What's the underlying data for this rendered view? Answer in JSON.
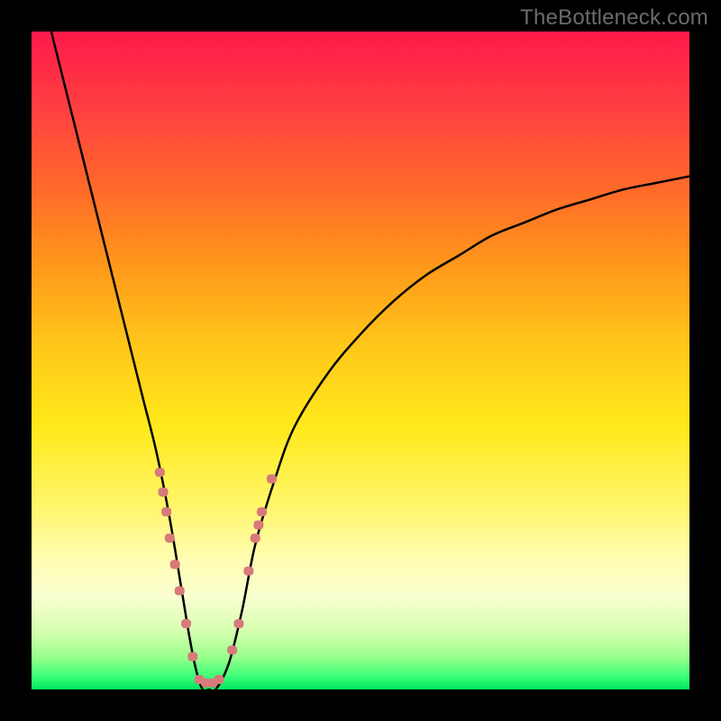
{
  "watermark": "TheBottleneck.com",
  "chart_data": {
    "type": "line",
    "title": "",
    "xlabel": "",
    "ylabel": "",
    "xlim": [
      0,
      100
    ],
    "ylim": [
      0,
      100
    ],
    "background_gradient": {
      "top": "#ff1a4b",
      "middle": "#ffe91a",
      "bottom": "#00e760"
    },
    "series": [
      {
        "name": "bottleneck-curve",
        "x": [
          3,
          5,
          7,
          9,
          11,
          13,
          15,
          17,
          19,
          21,
          23,
          24,
          25,
          26,
          27,
          28,
          30,
          32,
          34,
          37,
          40,
          45,
          50,
          55,
          60,
          65,
          70,
          75,
          80,
          85,
          90,
          95,
          100
        ],
        "y": [
          100,
          92,
          84,
          76,
          68,
          60,
          52,
          44,
          36,
          26,
          14,
          8,
          3,
          0,
          0,
          0,
          4,
          12,
          22,
          32,
          40,
          48,
          54,
          59,
          63,
          66,
          69,
          71,
          73,
          74.5,
          76,
          77,
          78
        ],
        "color": "#000000"
      }
    ],
    "markers": {
      "name": "data-points",
      "color": "#d77a7a",
      "points": [
        {
          "x": 19.5,
          "y": 33
        },
        {
          "x": 20.0,
          "y": 30
        },
        {
          "x": 20.5,
          "y": 27
        },
        {
          "x": 21.0,
          "y": 23
        },
        {
          "x": 21.8,
          "y": 19
        },
        {
          "x": 22.5,
          "y": 15
        },
        {
          "x": 23.5,
          "y": 10
        },
        {
          "x": 24.5,
          "y": 5
        },
        {
          "x": 25.5,
          "y": 1.5
        },
        {
          "x": 26.5,
          "y": 1.0
        },
        {
          "x": 27.5,
          "y": 1.0
        },
        {
          "x": 28.5,
          "y": 1.5
        },
        {
          "x": 30.5,
          "y": 6
        },
        {
          "x": 31.5,
          "y": 10
        },
        {
          "x": 33.0,
          "y": 18
        },
        {
          "x": 34.0,
          "y": 23
        },
        {
          "x": 34.5,
          "y": 25
        },
        {
          "x": 35.0,
          "y": 27
        },
        {
          "x": 36.5,
          "y": 32
        }
      ]
    }
  }
}
